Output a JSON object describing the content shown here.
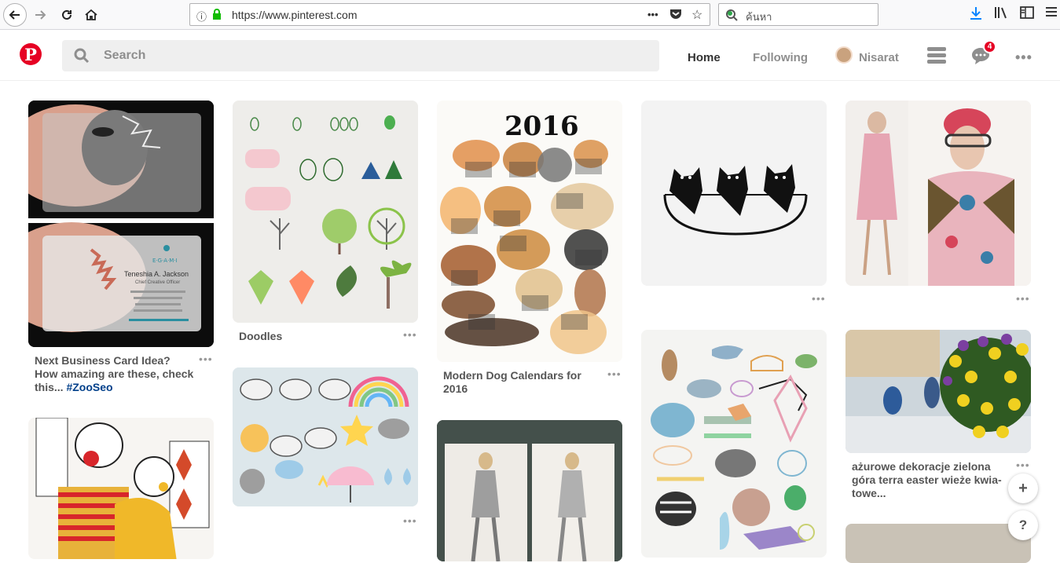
{
  "browser": {
    "url": "https://www.pinterest.com",
    "search_placeholder": "ค้นหา"
  },
  "header": {
    "search_placeholder": "Search",
    "nav": {
      "home": "Home",
      "following": "Following",
      "user": "Nisarat"
    },
    "notification_count": "4"
  },
  "pins": [
    {
      "title": "Next Business Card Idea? How amazing are these, check this...",
      "tag": "#ZooSeo"
    },
    {
      "title": "Doodles"
    },
    {
      "title": "Modern Dog Calendars for 2016"
    },
    {
      "title": "ażurowe dekoracje zielona góra terra easter wieże kwia-towe..."
    }
  ],
  "images": {
    "card_name": "Teneshia A. Jackson",
    "card_role": "Chief Creative Officer",
    "card_brand": "E·G·A·M·I",
    "calendar_year": "2016"
  },
  "fab": {
    "add": "+",
    "help": "?"
  },
  "colors": {
    "brand": "#e60023",
    "link": "#003f8a"
  }
}
